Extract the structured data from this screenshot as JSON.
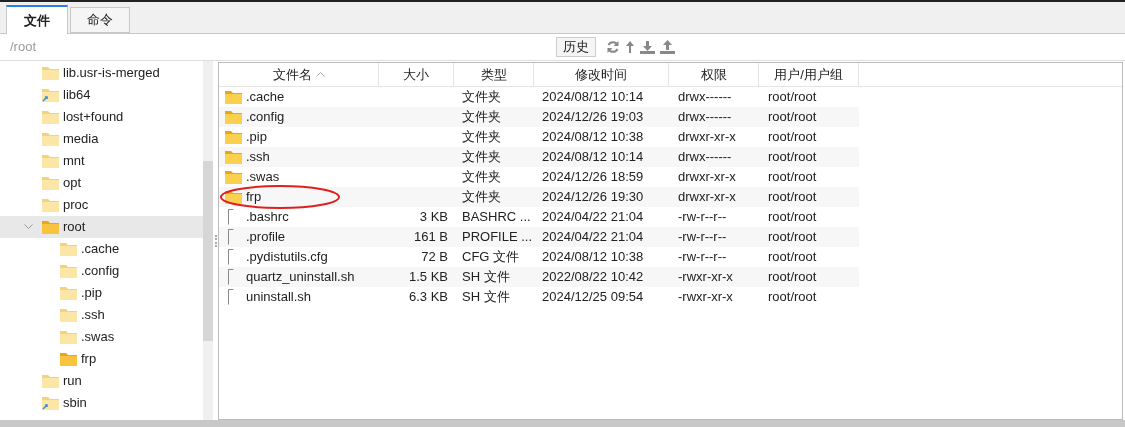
{
  "tabs": [
    {
      "label": "文件",
      "selected": true
    },
    {
      "label": "命令",
      "selected": false
    }
  ],
  "path_bar": {
    "path": "/root",
    "history_button": "历史"
  },
  "tree": [
    {
      "label": "lib.usr-is-merged",
      "kind": "folder",
      "selected": false
    },
    {
      "label": "lib64",
      "kind": "link",
      "selected": false
    },
    {
      "label": "lost+found",
      "kind": "folder",
      "selected": false
    },
    {
      "label": "media",
      "kind": "folder",
      "selected": false
    },
    {
      "label": "mnt",
      "kind": "folder",
      "selected": false
    },
    {
      "label": "opt",
      "kind": "folder",
      "selected": false
    },
    {
      "label": "proc",
      "kind": "folder",
      "selected": false
    },
    {
      "label": "root",
      "kind": "folder-dark",
      "selected": true,
      "expanded": true,
      "children": [
        {
          "label": ".cache",
          "kind": "folder",
          "selected": false
        },
        {
          "label": ".config",
          "kind": "folder",
          "selected": false
        },
        {
          "label": ".pip",
          "kind": "folder",
          "selected": false
        },
        {
          "label": ".ssh",
          "kind": "folder",
          "selected": false
        },
        {
          "label": ".swas",
          "kind": "folder",
          "selected": false
        },
        {
          "label": "frp",
          "kind": "folder-dark",
          "selected": false
        }
      ]
    },
    {
      "label": "run",
      "kind": "folder",
      "selected": false
    },
    {
      "label": "sbin",
      "kind": "link",
      "selected": false
    }
  ],
  "table": {
    "columns": [
      {
        "label": "文件名",
        "sorted": true
      },
      {
        "label": "大小",
        "sorted": false
      },
      {
        "label": "类型",
        "sorted": false
      },
      {
        "label": "修改时间",
        "sorted": false
      },
      {
        "label": "权限",
        "sorted": false
      },
      {
        "label": "用户/用户组",
        "sorted": false
      }
    ],
    "rows": [
      {
        "kind": "folder",
        "name": ".cache",
        "size": "",
        "type": "文件夹",
        "modified": "2024/08/12 10:14",
        "permissions": "drwx------",
        "owner": "root/root",
        "circled": false
      },
      {
        "kind": "folder",
        "name": ".config",
        "size": "",
        "type": "文件夹",
        "modified": "2024/12/26 19:03",
        "permissions": "drwx------",
        "owner": "root/root",
        "circled": false
      },
      {
        "kind": "folder",
        "name": ".pip",
        "size": "",
        "type": "文件夹",
        "modified": "2024/08/12 10:38",
        "permissions": "drwxr-xr-x",
        "owner": "root/root",
        "circled": false
      },
      {
        "kind": "folder",
        "name": ".ssh",
        "size": "",
        "type": "文件夹",
        "modified": "2024/08/12 10:14",
        "permissions": "drwx------",
        "owner": "root/root",
        "circled": false
      },
      {
        "kind": "folder",
        "name": ".swas",
        "size": "",
        "type": "文件夹",
        "modified": "2024/12/26 18:59",
        "permissions": "drwxr-xr-x",
        "owner": "root/root",
        "circled": false
      },
      {
        "kind": "folder",
        "name": "frp",
        "size": "",
        "type": "文件夹",
        "modified": "2024/12/26 19:30",
        "permissions": "drwxr-xr-x",
        "owner": "root/root",
        "circled": true
      },
      {
        "kind": "file",
        "name": ".bashrc",
        "size": "3 KB",
        "type": "BASHRC ...",
        "modified": "2024/04/22 21:04",
        "permissions": "-rw-r--r--",
        "owner": "root/root",
        "circled": false
      },
      {
        "kind": "file",
        "name": ".profile",
        "size": "161 B",
        "type": "PROFILE ...",
        "modified": "2024/04/22 21:04",
        "permissions": "-rw-r--r--",
        "owner": "root/root",
        "circled": false
      },
      {
        "kind": "file",
        "name": ".pydistutils.cfg",
        "size": "72 B",
        "type": "CFG 文件",
        "modified": "2024/08/12 10:38",
        "permissions": "-rw-r--r--",
        "owner": "root/root",
        "circled": false
      },
      {
        "kind": "file",
        "name": "quartz_uninstall.sh",
        "size": "1.5 KB",
        "type": "SH 文件",
        "modified": "2022/08/22 10:42",
        "permissions": "-rwxr-xr-x",
        "owner": "root/root",
        "circled": false
      },
      {
        "kind": "file",
        "name": "uninstall.sh",
        "size": "6.3 KB",
        "type": "SH 文件",
        "modified": "2024/12/25 09:54",
        "permissions": "-rwxr-xr-x",
        "owner": "root/root",
        "circled": false
      }
    ]
  }
}
